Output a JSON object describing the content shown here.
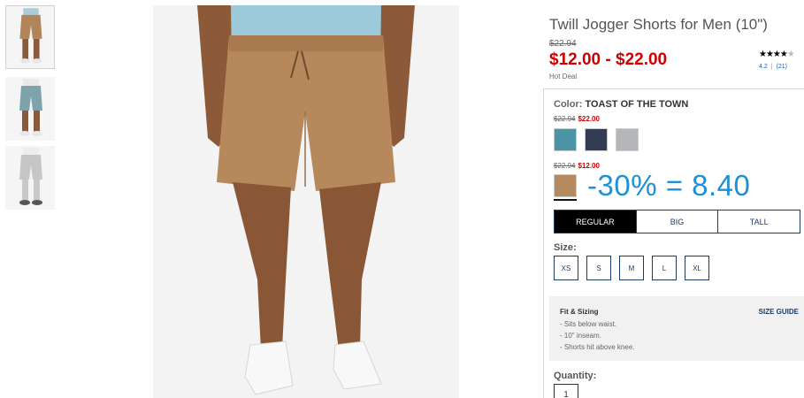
{
  "thumbnails": [
    {
      "label": "khaki shorts view",
      "color": "#b28459",
      "selected": true
    },
    {
      "label": "blue shorts view",
      "color": "#7fa3ad",
      "selected": false
    },
    {
      "label": "grey shorts view",
      "color": "#c6c6c6",
      "selected": false
    }
  ],
  "product": {
    "title": "Twill Jogger Shorts for Men (10\")",
    "original_price": "$22.94",
    "price_range": "$12.00 - $22.00",
    "deal_label": "Hot Deal",
    "rating": {
      "stars": "★★★★",
      "empty_star": "★",
      "value": "4.2",
      "count": "(21)",
      "fraction": 0.84
    }
  },
  "color": {
    "label": "Color:",
    "selected_name": "TOAST OF THE TOWN",
    "group1_price": {
      "original": "$22.94",
      "sale": "$22.00"
    },
    "group1_swatches": [
      {
        "name": "teal",
        "hex": "#4a94a6"
      },
      {
        "name": "navy",
        "hex": "#323c52"
      },
      {
        "name": "grey",
        "hex": "#b4b6b9"
      }
    ],
    "group2_price": {
      "original": "$22.94",
      "sale": "$12.00"
    },
    "group2_swatches": [
      {
        "name": "toast of the town",
        "hex": "#b48a5e"
      }
    ]
  },
  "annotation": "-30% = 8.40",
  "fit_tabs": [
    "REGULAR",
    "BIG",
    "TALL"
  ],
  "active_fit": "REGULAR",
  "size": {
    "label": "Size:",
    "options": [
      "XS",
      "S",
      "M",
      "L",
      "XL"
    ]
  },
  "fit_sizing": {
    "title": "Fit & Sizing",
    "guide_link": "SIZE GUIDE",
    "bullets": [
      "- Sits below waist.",
      "- 10\" inseam.",
      "- Shorts hit above knee."
    ]
  },
  "quantity": {
    "label": "Quantity:",
    "value": "1"
  },
  "colors": {
    "sale_red": "#cc0000",
    "accent_navy": "#1a3c66",
    "annotation_blue": "#1e90d6"
  }
}
